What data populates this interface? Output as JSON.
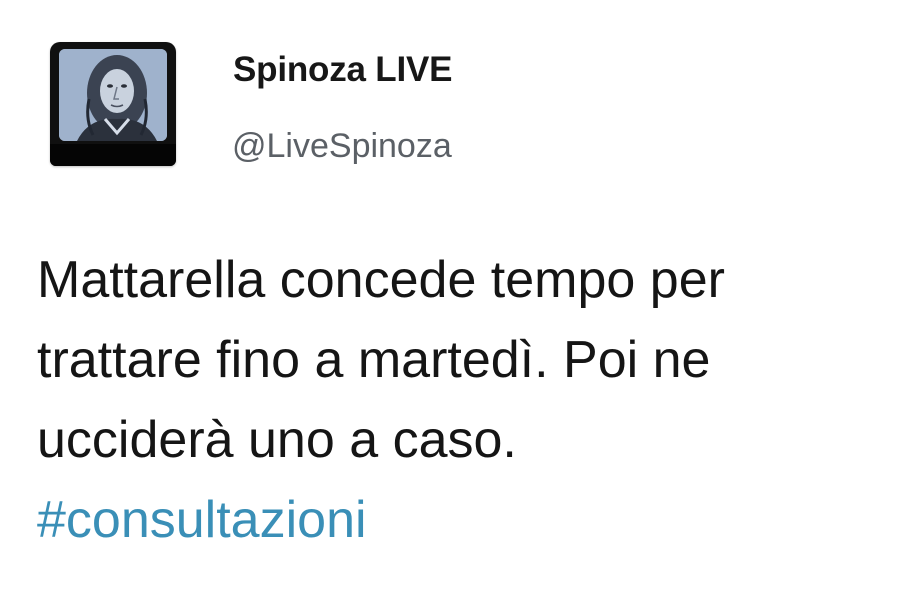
{
  "tweet": {
    "author_name": "Spinoza LIVE",
    "author_handle": "@LiveSpinoza",
    "avatar_icon": "vintage-tv-portrait-avatar",
    "text_lines": [
      "Mattarella concede tempo per",
      "trattare fino a martedì. Poi ne",
      "ucciderà uno a caso."
    ],
    "hashtag": "#consultazioni",
    "hashtag_color": "#3a8fb7"
  }
}
